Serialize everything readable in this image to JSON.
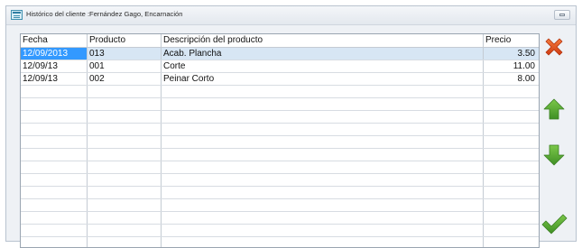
{
  "window": {
    "title": "Histórico del cliente :Fernández Gago, Encarnación"
  },
  "table": {
    "columns": [
      "Fecha",
      "Producto",
      "Descripción del producto",
      "Precio"
    ],
    "rows": [
      {
        "fecha": "12/09/2013",
        "producto": "013",
        "descripcion": "Acab. Plancha",
        "precio": "3.50"
      },
      {
        "fecha": "12/09/13",
        "producto": "001",
        "descripcion": "Corte",
        "precio": "11.00"
      },
      {
        "fecha": "12/09/13",
        "producto": "002",
        "descripcion": "Peinar  Corto",
        "precio": "8.00"
      }
    ],
    "selected_row": 0,
    "empty_rows": 13
  },
  "actions": {
    "close_icon": "close-x-icon",
    "up_icon": "arrow-up-icon",
    "down_icon": "arrow-down-icon",
    "accept_icon": "checkmark-icon"
  },
  "colors": {
    "selection": "#3399ff",
    "close_red": "#e2541f",
    "arrow_green": "#55a830"
  }
}
